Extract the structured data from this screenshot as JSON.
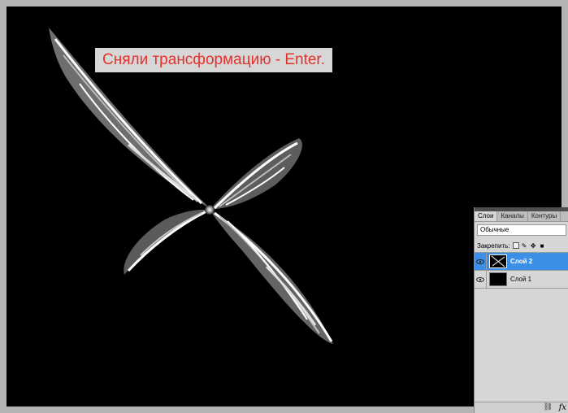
{
  "callout": {
    "text": "Сняли трансформацию - Enter."
  },
  "layers_panel": {
    "tabs": [
      {
        "label": "Слои",
        "active": true
      },
      {
        "label": "Каналы",
        "active": false
      },
      {
        "label": "Контуры",
        "active": false
      }
    ],
    "blend_mode": "Обычные",
    "lock_label": "Закрепить:",
    "layers": [
      {
        "name": "Слой 2",
        "selected": true,
        "visible": true
      },
      {
        "name": "Слой 1",
        "selected": false,
        "visible": true
      }
    ],
    "fx_label": "fx",
    "link_icon": "link-icon"
  },
  "colors": {
    "canvas": "#000000",
    "workspace": "#b4b4b4",
    "callout_text": "#e8302b",
    "callout_bg": "#d7d7d7",
    "selected_layer": "#3b8fe6"
  }
}
